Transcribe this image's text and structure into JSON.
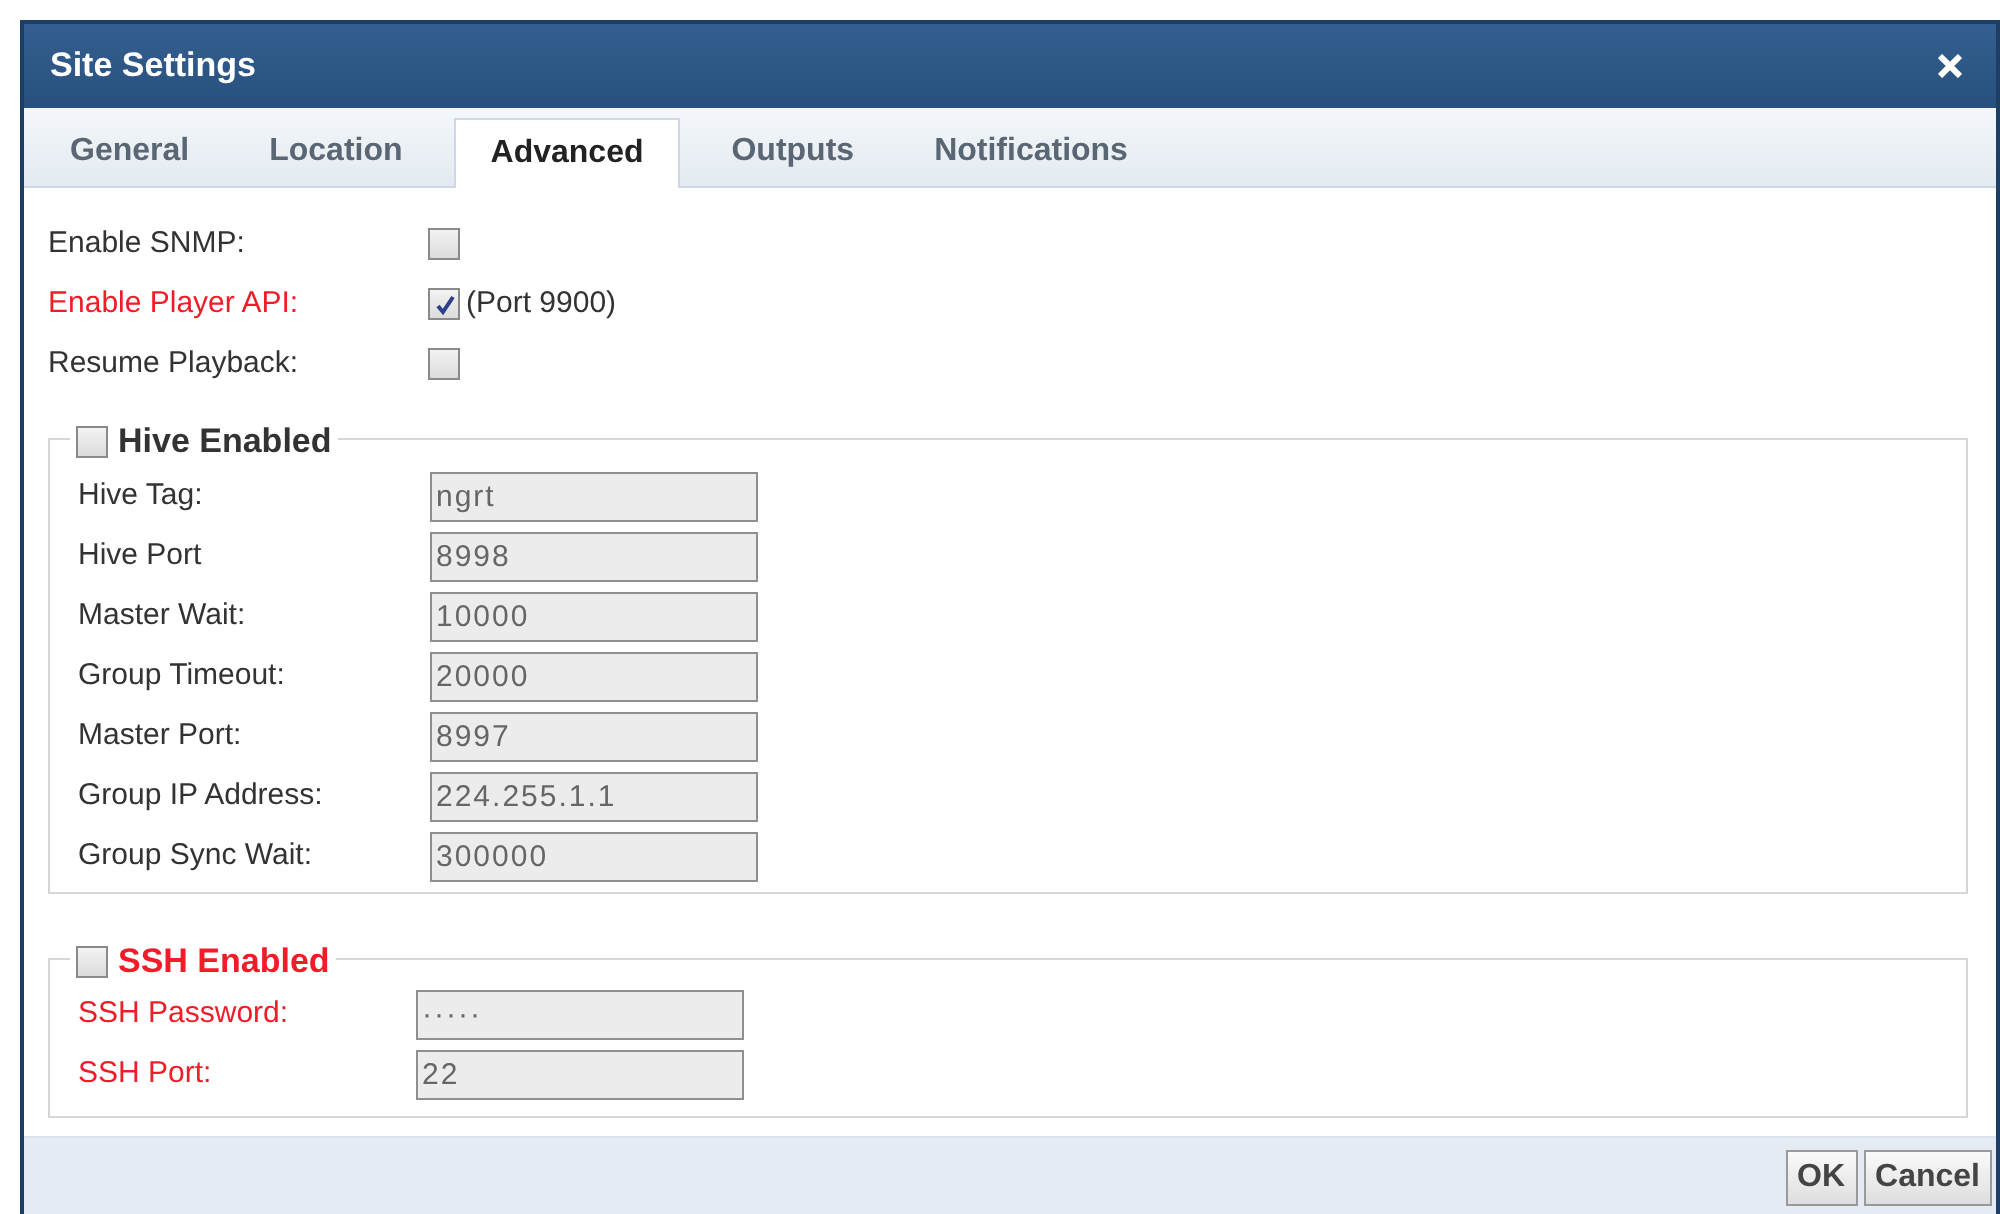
{
  "dialog": {
    "title": "Site Settings"
  },
  "tabs": [
    {
      "label": "General",
      "selected": false
    },
    {
      "label": "Location",
      "selected": false
    },
    {
      "label": "Advanced",
      "selected": true
    },
    {
      "label": "Outputs",
      "selected": false
    },
    {
      "label": "Notifications",
      "selected": false
    }
  ],
  "options": [
    {
      "label": "Enable SNMP:",
      "checked": false,
      "warning": false
    },
    {
      "label": "Enable Player API:",
      "checked": true,
      "warning": true,
      "note": "(Port 9900)"
    },
    {
      "label": "Resume Playback:",
      "checked": false,
      "warning": false
    }
  ],
  "groups": [
    {
      "title": "Hive Enabled",
      "checked": false,
      "warning": false,
      "fields": [
        {
          "label": "Hive Tag:",
          "value": "ngrt"
        },
        {
          "label": "Hive Port",
          "value": "8998"
        },
        {
          "label": "Master Wait:",
          "value": "10000"
        },
        {
          "label": "Group Timeout:",
          "value": "20000"
        },
        {
          "label": "Master Port:",
          "value": "8997"
        },
        {
          "label": "Group IP Address:",
          "value": "224.255.1.1"
        },
        {
          "label": "Group Sync Wait:",
          "value": "300000"
        }
      ]
    },
    {
      "title": "SSH Enabled",
      "checked": false,
      "warning": true,
      "fields": [
        {
          "label": "SSH Password:",
          "value": "·····"
        },
        {
          "label": "SSH Port:",
          "value": "22"
        }
      ]
    }
  ],
  "buttons": [
    "OK",
    "Cancel"
  ]
}
